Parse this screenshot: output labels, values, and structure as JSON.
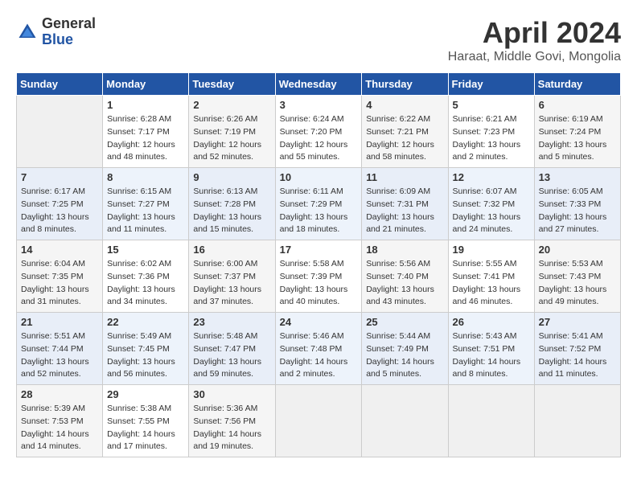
{
  "header": {
    "logo_general": "General",
    "logo_blue": "Blue",
    "month_title": "April 2024",
    "subtitle": "Haraat, Middle Govi, Mongolia"
  },
  "days_of_week": [
    "Sunday",
    "Monday",
    "Tuesday",
    "Wednesday",
    "Thursday",
    "Friday",
    "Saturday"
  ],
  "weeks": [
    [
      {
        "day": "",
        "info": ""
      },
      {
        "day": "1",
        "info": "Sunrise: 6:28 AM\nSunset: 7:17 PM\nDaylight: 12 hours\nand 48 minutes."
      },
      {
        "day": "2",
        "info": "Sunrise: 6:26 AM\nSunset: 7:19 PM\nDaylight: 12 hours\nand 52 minutes."
      },
      {
        "day": "3",
        "info": "Sunrise: 6:24 AM\nSunset: 7:20 PM\nDaylight: 12 hours\nand 55 minutes."
      },
      {
        "day": "4",
        "info": "Sunrise: 6:22 AM\nSunset: 7:21 PM\nDaylight: 12 hours\nand 58 minutes."
      },
      {
        "day": "5",
        "info": "Sunrise: 6:21 AM\nSunset: 7:23 PM\nDaylight: 13 hours\nand 2 minutes."
      },
      {
        "day": "6",
        "info": "Sunrise: 6:19 AM\nSunset: 7:24 PM\nDaylight: 13 hours\nand 5 minutes."
      }
    ],
    [
      {
        "day": "7",
        "info": "Sunrise: 6:17 AM\nSunset: 7:25 PM\nDaylight: 13 hours\nand 8 minutes."
      },
      {
        "day": "8",
        "info": "Sunrise: 6:15 AM\nSunset: 7:27 PM\nDaylight: 13 hours\nand 11 minutes."
      },
      {
        "day": "9",
        "info": "Sunrise: 6:13 AM\nSunset: 7:28 PM\nDaylight: 13 hours\nand 15 minutes."
      },
      {
        "day": "10",
        "info": "Sunrise: 6:11 AM\nSunset: 7:29 PM\nDaylight: 13 hours\nand 18 minutes."
      },
      {
        "day": "11",
        "info": "Sunrise: 6:09 AM\nSunset: 7:31 PM\nDaylight: 13 hours\nand 21 minutes."
      },
      {
        "day": "12",
        "info": "Sunrise: 6:07 AM\nSunset: 7:32 PM\nDaylight: 13 hours\nand 24 minutes."
      },
      {
        "day": "13",
        "info": "Sunrise: 6:05 AM\nSunset: 7:33 PM\nDaylight: 13 hours\nand 27 minutes."
      }
    ],
    [
      {
        "day": "14",
        "info": "Sunrise: 6:04 AM\nSunset: 7:35 PM\nDaylight: 13 hours\nand 31 minutes."
      },
      {
        "day": "15",
        "info": "Sunrise: 6:02 AM\nSunset: 7:36 PM\nDaylight: 13 hours\nand 34 minutes."
      },
      {
        "day": "16",
        "info": "Sunrise: 6:00 AM\nSunset: 7:37 PM\nDaylight: 13 hours\nand 37 minutes."
      },
      {
        "day": "17",
        "info": "Sunrise: 5:58 AM\nSunset: 7:39 PM\nDaylight: 13 hours\nand 40 minutes."
      },
      {
        "day": "18",
        "info": "Sunrise: 5:56 AM\nSunset: 7:40 PM\nDaylight: 13 hours\nand 43 minutes."
      },
      {
        "day": "19",
        "info": "Sunrise: 5:55 AM\nSunset: 7:41 PM\nDaylight: 13 hours\nand 46 minutes."
      },
      {
        "day": "20",
        "info": "Sunrise: 5:53 AM\nSunset: 7:43 PM\nDaylight: 13 hours\nand 49 minutes."
      }
    ],
    [
      {
        "day": "21",
        "info": "Sunrise: 5:51 AM\nSunset: 7:44 PM\nDaylight: 13 hours\nand 52 minutes."
      },
      {
        "day": "22",
        "info": "Sunrise: 5:49 AM\nSunset: 7:45 PM\nDaylight: 13 hours\nand 56 minutes."
      },
      {
        "day": "23",
        "info": "Sunrise: 5:48 AM\nSunset: 7:47 PM\nDaylight: 13 hours\nand 59 minutes."
      },
      {
        "day": "24",
        "info": "Sunrise: 5:46 AM\nSunset: 7:48 PM\nDaylight: 14 hours\nand 2 minutes."
      },
      {
        "day": "25",
        "info": "Sunrise: 5:44 AM\nSunset: 7:49 PM\nDaylight: 14 hours\nand 5 minutes."
      },
      {
        "day": "26",
        "info": "Sunrise: 5:43 AM\nSunset: 7:51 PM\nDaylight: 14 hours\nand 8 minutes."
      },
      {
        "day": "27",
        "info": "Sunrise: 5:41 AM\nSunset: 7:52 PM\nDaylight: 14 hours\nand 11 minutes."
      }
    ],
    [
      {
        "day": "28",
        "info": "Sunrise: 5:39 AM\nSunset: 7:53 PM\nDaylight: 14 hours\nand 14 minutes."
      },
      {
        "day": "29",
        "info": "Sunrise: 5:38 AM\nSunset: 7:55 PM\nDaylight: 14 hours\nand 17 minutes."
      },
      {
        "day": "30",
        "info": "Sunrise: 5:36 AM\nSunset: 7:56 PM\nDaylight: 14 hours\nand 19 minutes."
      },
      {
        "day": "",
        "info": ""
      },
      {
        "day": "",
        "info": ""
      },
      {
        "day": "",
        "info": ""
      },
      {
        "day": "",
        "info": ""
      }
    ]
  ]
}
